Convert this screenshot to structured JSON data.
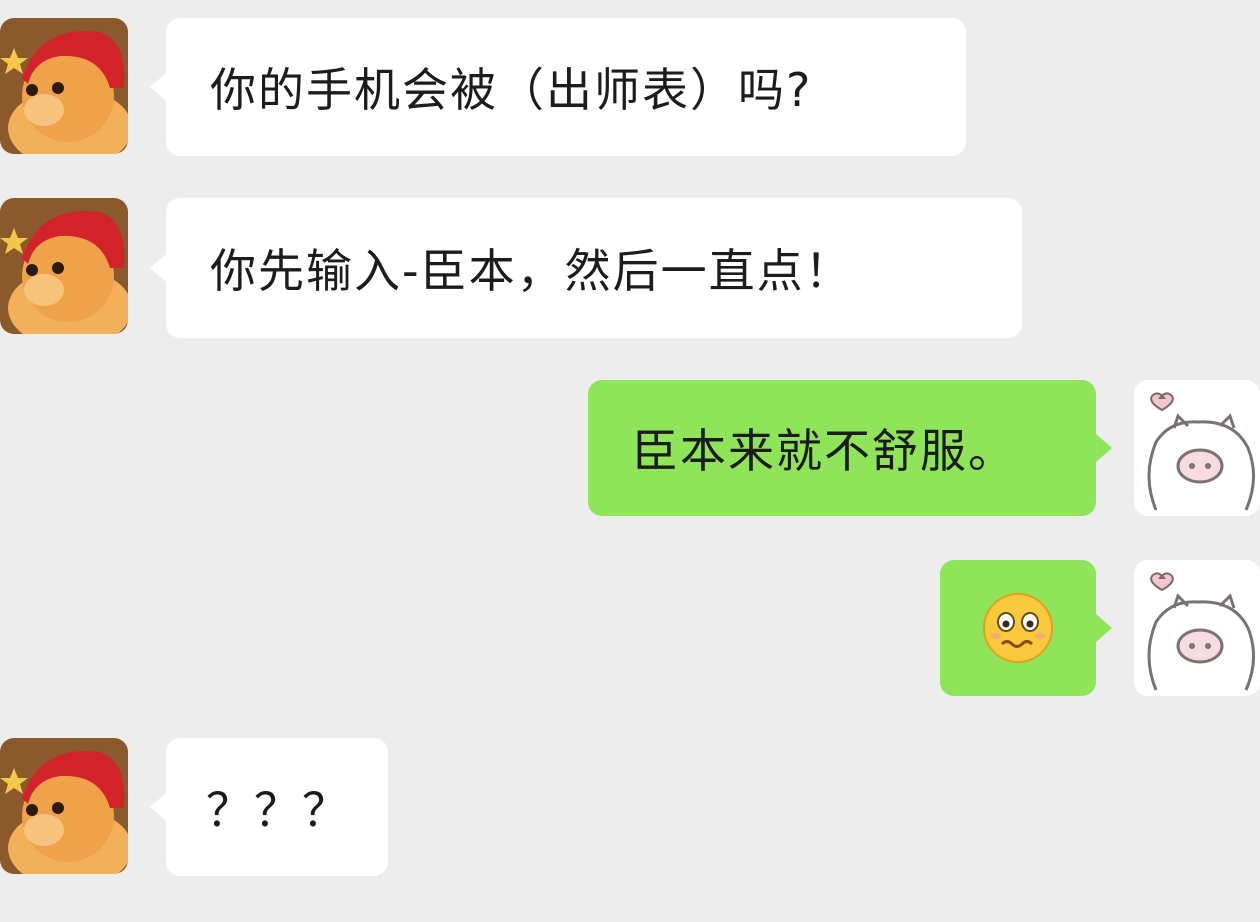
{
  "messages": [
    {
      "direction": "incoming",
      "sender_avatar": "red-hat-doll-avatar",
      "text": "你的手机会被（出师表）吗?"
    },
    {
      "direction": "incoming",
      "sender_avatar": "red-hat-doll-avatar",
      "text": "你先输入-臣本，然后一直点！"
    },
    {
      "direction": "outgoing",
      "sender_avatar": "pig-sketch-avatar",
      "text": "臣本来就不舒服。"
    },
    {
      "direction": "outgoing",
      "sender_avatar": "pig-sketch-avatar",
      "emoji": "worried-face-emoji"
    },
    {
      "direction": "incoming",
      "sender_avatar": "red-hat-doll-avatar",
      "text": "？？？"
    }
  ],
  "colors": {
    "background": "#ededed",
    "incoming_bubble": "#ffffff",
    "outgoing_bubble": "#8fe45a",
    "text": "#1c1c1c"
  }
}
